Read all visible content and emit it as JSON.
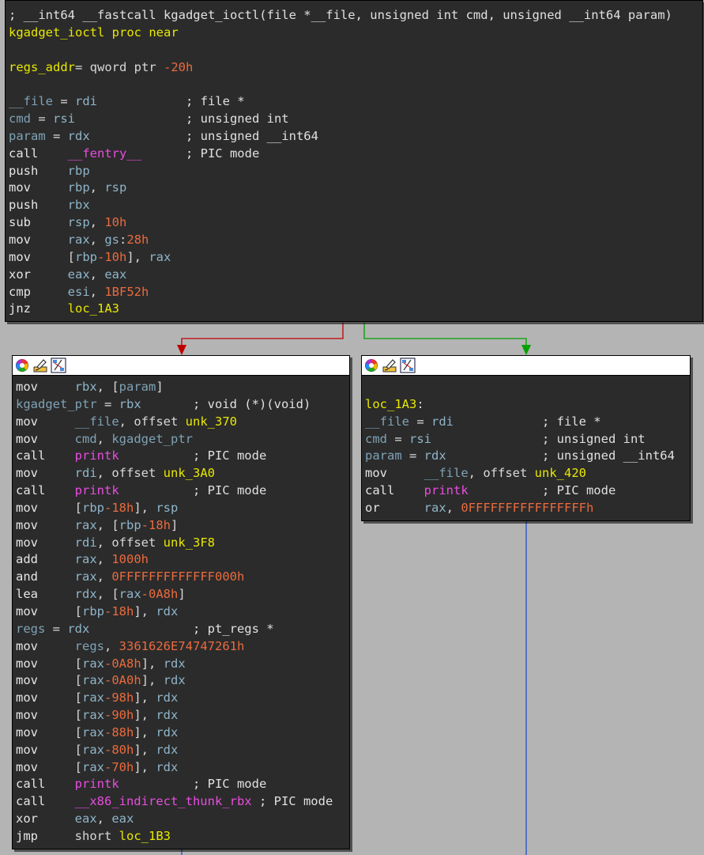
{
  "colors": {
    "background": "#b4b4b4",
    "node_bg": "#2b2b2b",
    "edge_false": "#c00000",
    "edge_true": "#00a000",
    "edge_normal": "#2050d0"
  },
  "header_icons": [
    "color-palette-icon",
    "rename-edit-icon",
    "graph-nodes-icon"
  ],
  "nodes": {
    "top": {
      "lines": [
        [
          [
            "; __int64 __fastcall kgadget_ioctl(file *__file, unsigned int cmd, unsigned __int64 param)",
            "comment"
          ]
        ],
        [
          [
            "kgadget_ioctl",
            "name"
          ],
          [
            " proc near",
            "kw"
          ]
        ],
        [
          [
            "",
            "plain"
          ]
        ],
        [
          [
            "regs_addr",
            "name"
          ],
          [
            "= qword ptr ",
            "plain"
          ],
          [
            "-20h",
            "num"
          ]
        ],
        [
          [
            "",
            "plain"
          ]
        ],
        [
          [
            "__file",
            "var"
          ],
          [
            " = ",
            "plain"
          ],
          [
            "rdi",
            "reg"
          ],
          [
            "            ; file *",
            "comment"
          ]
        ],
        [
          [
            "cmd",
            "var"
          ],
          [
            " = ",
            "plain"
          ],
          [
            "rsi",
            "reg"
          ],
          [
            "               ; unsigned int",
            "comment"
          ]
        ],
        [
          [
            "param",
            "var"
          ],
          [
            " = ",
            "plain"
          ],
          [
            "rdx",
            "reg"
          ],
          [
            "             ; unsigned __int64",
            "comment"
          ]
        ],
        [
          [
            "call",
            "mnem"
          ],
          [
            "    ",
            "plain"
          ],
          [
            "__fentry__",
            "func"
          ],
          [
            "      ; PIC mode",
            "comment"
          ]
        ],
        [
          [
            "push",
            "mnem"
          ],
          [
            "    ",
            "plain"
          ],
          [
            "rbp",
            "reg"
          ]
        ],
        [
          [
            "mov",
            "mnem"
          ],
          [
            "     ",
            "plain"
          ],
          [
            "rbp",
            "reg"
          ],
          [
            ", ",
            "plain"
          ],
          [
            "rsp",
            "reg"
          ]
        ],
        [
          [
            "push",
            "mnem"
          ],
          [
            "    ",
            "plain"
          ],
          [
            "rbx",
            "reg"
          ]
        ],
        [
          [
            "sub",
            "mnem"
          ],
          [
            "     ",
            "plain"
          ],
          [
            "rsp",
            "reg"
          ],
          [
            ", ",
            "plain"
          ],
          [
            "10h",
            "num"
          ]
        ],
        [
          [
            "mov",
            "mnem"
          ],
          [
            "     ",
            "plain"
          ],
          [
            "rax",
            "reg"
          ],
          [
            ", ",
            "plain"
          ],
          [
            "gs",
            "reg"
          ],
          [
            ":",
            "plain"
          ],
          [
            "28h",
            "num"
          ]
        ],
        [
          [
            "mov",
            "mnem"
          ],
          [
            "     ",
            "plain"
          ],
          [
            "[",
            "plain"
          ],
          [
            "rbp",
            "reg"
          ],
          [
            "-10h",
            "num"
          ],
          [
            "], ",
            "plain"
          ],
          [
            "rax",
            "reg"
          ]
        ],
        [
          [
            "xor",
            "mnem"
          ],
          [
            "     ",
            "plain"
          ],
          [
            "eax",
            "reg"
          ],
          [
            ", ",
            "plain"
          ],
          [
            "eax",
            "reg"
          ]
        ],
        [
          [
            "cmp",
            "mnem"
          ],
          [
            "     ",
            "plain"
          ],
          [
            "esi",
            "reg"
          ],
          [
            ", ",
            "plain"
          ],
          [
            "1BF52h",
            "num"
          ]
        ],
        [
          [
            "jnz",
            "mnem"
          ],
          [
            "     ",
            "plain"
          ],
          [
            "loc_1A3",
            "label"
          ]
        ]
      ]
    },
    "left": {
      "lines": [
        [
          [
            "mov",
            "mnem"
          ],
          [
            "     ",
            "plain"
          ],
          [
            "rbx",
            "reg"
          ],
          [
            ", [",
            "plain"
          ],
          [
            "param",
            "var"
          ],
          [
            "]",
            "plain"
          ]
        ],
        [
          [
            "kgadget_ptr",
            "var"
          ],
          [
            " = ",
            "plain"
          ],
          [
            "rbx",
            "reg"
          ],
          [
            "       ; void (*)(void)",
            "comment"
          ]
        ],
        [
          [
            "mov",
            "mnem"
          ],
          [
            "     ",
            "plain"
          ],
          [
            "__file",
            "var"
          ],
          [
            ", offset ",
            "plain"
          ],
          [
            "unk_370",
            "label"
          ]
        ],
        [
          [
            "mov",
            "mnem"
          ],
          [
            "     ",
            "plain"
          ],
          [
            "cmd",
            "var"
          ],
          [
            ", ",
            "plain"
          ],
          [
            "kgadget_ptr",
            "var"
          ]
        ],
        [
          [
            "call",
            "mnem"
          ],
          [
            "    ",
            "plain"
          ],
          [
            "printk",
            "func"
          ],
          [
            "          ; PIC mode",
            "comment"
          ]
        ],
        [
          [
            "mov",
            "mnem"
          ],
          [
            "     ",
            "plain"
          ],
          [
            "rdi",
            "reg"
          ],
          [
            ", offset ",
            "plain"
          ],
          [
            "unk_3A0",
            "label"
          ]
        ],
        [
          [
            "call",
            "mnem"
          ],
          [
            "    ",
            "plain"
          ],
          [
            "printk",
            "func"
          ],
          [
            "          ; PIC mode",
            "comment"
          ]
        ],
        [
          [
            "mov",
            "mnem"
          ],
          [
            "     ",
            "plain"
          ],
          [
            "[",
            "plain"
          ],
          [
            "rbp",
            "reg"
          ],
          [
            "-18h",
            "num"
          ],
          [
            "], ",
            "plain"
          ],
          [
            "rsp",
            "reg"
          ]
        ],
        [
          [
            "mov",
            "mnem"
          ],
          [
            "     ",
            "plain"
          ],
          [
            "rax",
            "reg"
          ],
          [
            ", [",
            "plain"
          ],
          [
            "rbp",
            "reg"
          ],
          [
            "-18h",
            "num"
          ],
          [
            "]",
            "plain"
          ]
        ],
        [
          [
            "mov",
            "mnem"
          ],
          [
            "     ",
            "plain"
          ],
          [
            "rdi",
            "reg"
          ],
          [
            ", offset ",
            "plain"
          ],
          [
            "unk_3F8",
            "label"
          ]
        ],
        [
          [
            "add",
            "mnem"
          ],
          [
            "     ",
            "plain"
          ],
          [
            "rax",
            "reg"
          ],
          [
            ", ",
            "plain"
          ],
          [
            "1000h",
            "num"
          ]
        ],
        [
          [
            "and",
            "mnem"
          ],
          [
            "     ",
            "plain"
          ],
          [
            "rax",
            "reg"
          ],
          [
            ", ",
            "plain"
          ],
          [
            "0FFFFFFFFFFFFF000h",
            "num"
          ]
        ],
        [
          [
            "lea",
            "mnem"
          ],
          [
            "     ",
            "plain"
          ],
          [
            "rdx",
            "reg"
          ],
          [
            ", [",
            "plain"
          ],
          [
            "rax",
            "reg"
          ],
          [
            "-0A8h",
            "num"
          ],
          [
            "]",
            "plain"
          ]
        ],
        [
          [
            "mov",
            "mnem"
          ],
          [
            "     ",
            "plain"
          ],
          [
            "[",
            "plain"
          ],
          [
            "rbp",
            "reg"
          ],
          [
            "-18h",
            "num"
          ],
          [
            "], ",
            "plain"
          ],
          [
            "rdx",
            "reg"
          ]
        ],
        [
          [
            "regs",
            "var"
          ],
          [
            " = ",
            "plain"
          ],
          [
            "rdx",
            "reg"
          ],
          [
            "              ; pt_regs *",
            "comment"
          ]
        ],
        [
          [
            "mov",
            "mnem"
          ],
          [
            "     ",
            "plain"
          ],
          [
            "regs",
            "var"
          ],
          [
            ", ",
            "plain"
          ],
          [
            "3361626E74747261h",
            "num"
          ]
        ],
        [
          [
            "mov",
            "mnem"
          ],
          [
            "     ",
            "plain"
          ],
          [
            "[",
            "plain"
          ],
          [
            "rax",
            "reg"
          ],
          [
            "-0A8h",
            "num"
          ],
          [
            "], ",
            "plain"
          ],
          [
            "rdx",
            "reg"
          ]
        ],
        [
          [
            "mov",
            "mnem"
          ],
          [
            "     ",
            "plain"
          ],
          [
            "[",
            "plain"
          ],
          [
            "rax",
            "reg"
          ],
          [
            "-0A0h",
            "num"
          ],
          [
            "], ",
            "plain"
          ],
          [
            "rdx",
            "reg"
          ]
        ],
        [
          [
            "mov",
            "mnem"
          ],
          [
            "     ",
            "plain"
          ],
          [
            "[",
            "plain"
          ],
          [
            "rax",
            "reg"
          ],
          [
            "-98h",
            "num"
          ],
          [
            "], ",
            "plain"
          ],
          [
            "rdx",
            "reg"
          ]
        ],
        [
          [
            "mov",
            "mnem"
          ],
          [
            "     ",
            "plain"
          ],
          [
            "[",
            "plain"
          ],
          [
            "rax",
            "reg"
          ],
          [
            "-90h",
            "num"
          ],
          [
            "], ",
            "plain"
          ],
          [
            "rdx",
            "reg"
          ]
        ],
        [
          [
            "mov",
            "mnem"
          ],
          [
            "     ",
            "plain"
          ],
          [
            "[",
            "plain"
          ],
          [
            "rax",
            "reg"
          ],
          [
            "-88h",
            "num"
          ],
          [
            "], ",
            "plain"
          ],
          [
            "rdx",
            "reg"
          ]
        ],
        [
          [
            "mov",
            "mnem"
          ],
          [
            "     ",
            "plain"
          ],
          [
            "[",
            "plain"
          ],
          [
            "rax",
            "reg"
          ],
          [
            "-80h",
            "num"
          ],
          [
            "], ",
            "plain"
          ],
          [
            "rdx",
            "reg"
          ]
        ],
        [
          [
            "mov",
            "mnem"
          ],
          [
            "     ",
            "plain"
          ],
          [
            "[",
            "plain"
          ],
          [
            "rax",
            "reg"
          ],
          [
            "-70h",
            "num"
          ],
          [
            "], ",
            "plain"
          ],
          [
            "rdx",
            "reg"
          ]
        ],
        [
          [
            "call",
            "mnem"
          ],
          [
            "    ",
            "plain"
          ],
          [
            "printk",
            "func"
          ],
          [
            "          ; PIC mode",
            "comment"
          ]
        ],
        [
          [
            "call",
            "mnem"
          ],
          [
            "    ",
            "plain"
          ],
          [
            "__x86_indirect_thunk_rbx",
            "func"
          ],
          [
            " ; PIC mode",
            "comment"
          ]
        ],
        [
          [
            "xor",
            "mnem"
          ],
          [
            "     ",
            "plain"
          ],
          [
            "eax",
            "reg"
          ],
          [
            ", ",
            "plain"
          ],
          [
            "eax",
            "reg"
          ]
        ],
        [
          [
            "jmp",
            "mnem"
          ],
          [
            "     short ",
            "plain"
          ],
          [
            "loc_1B3",
            "label"
          ]
        ]
      ]
    },
    "right": {
      "lines": [
        [
          [
            "",
            "plain"
          ]
        ],
        [
          [
            "loc_1A3",
            "label"
          ],
          [
            ":",
            "plain"
          ]
        ],
        [
          [
            "__file",
            "var"
          ],
          [
            " = ",
            "plain"
          ],
          [
            "rdi",
            "reg"
          ],
          [
            "            ; file *",
            "comment"
          ]
        ],
        [
          [
            "cmd",
            "var"
          ],
          [
            " = ",
            "plain"
          ],
          [
            "rsi",
            "reg"
          ],
          [
            "               ; unsigned int",
            "comment"
          ]
        ],
        [
          [
            "param",
            "var"
          ],
          [
            " = ",
            "plain"
          ],
          [
            "rdx",
            "reg"
          ],
          [
            "             ; unsigned __int64",
            "comment"
          ]
        ],
        [
          [
            "mov",
            "mnem"
          ],
          [
            "     ",
            "plain"
          ],
          [
            "__file",
            "var"
          ],
          [
            ", offset ",
            "plain"
          ],
          [
            "unk_420",
            "label"
          ]
        ],
        [
          [
            "call",
            "mnem"
          ],
          [
            "    ",
            "plain"
          ],
          [
            "printk",
            "func"
          ],
          [
            "          ; PIC mode",
            "comment"
          ]
        ],
        [
          [
            "or",
            "mnem"
          ],
          [
            "      ",
            "plain"
          ],
          [
            "rax",
            "reg"
          ],
          [
            ", ",
            "plain"
          ],
          [
            "0FFFFFFFFFFFFFFFFh",
            "num"
          ]
        ]
      ]
    }
  }
}
